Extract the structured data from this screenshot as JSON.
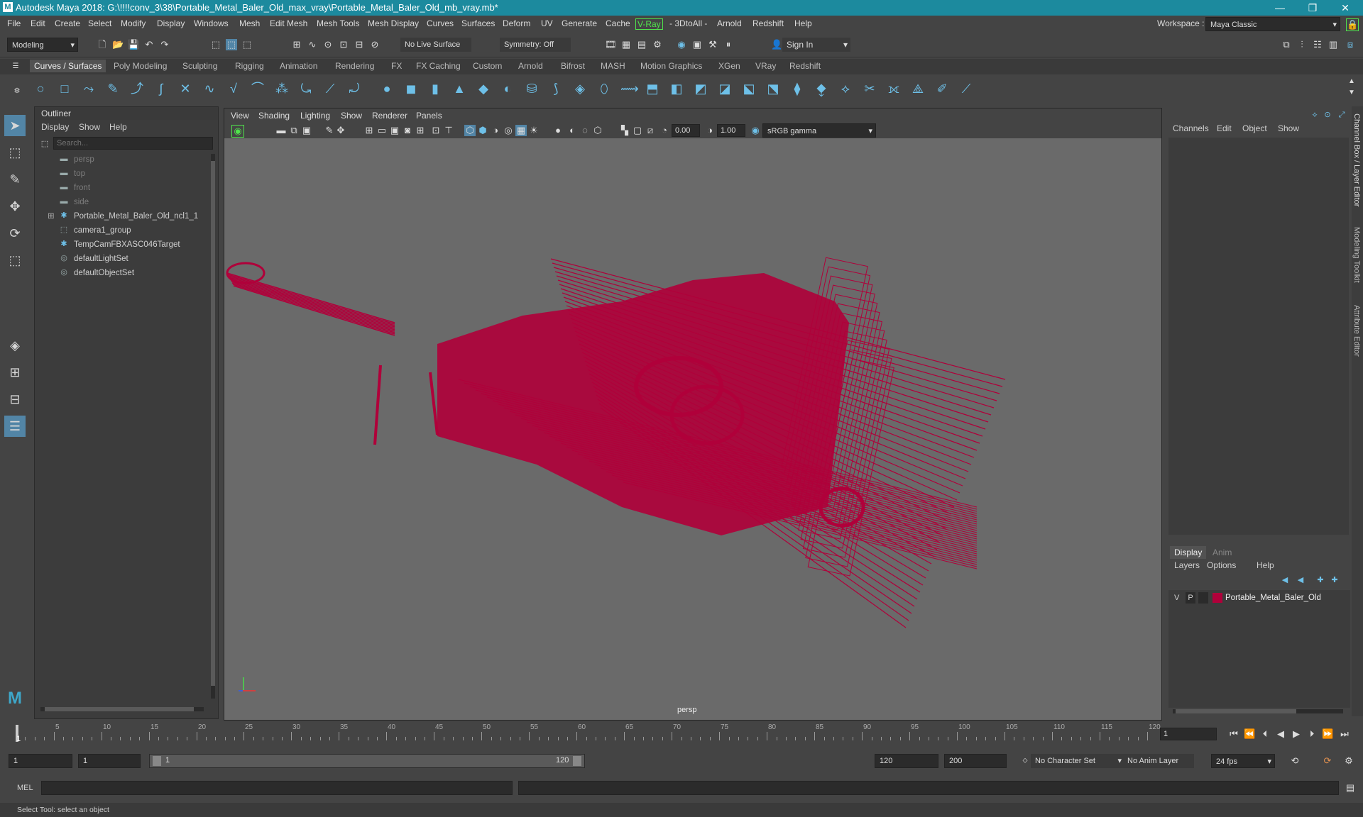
{
  "title_bar": {
    "logo": "M",
    "title": "Autodesk Maya 2018: G:\\!!!!conv_3\\38\\Portable_Metal_Baler_Old_max_vray\\Portable_Metal_Baler_Old_mb_vray.mb*",
    "minimize": "—",
    "maximize": "❐",
    "close": "✕"
  },
  "menubar": {
    "items": [
      "File",
      "Edit",
      "Create",
      "Select",
      "Modify",
      "Display",
      "Windows",
      "Mesh",
      "Edit Mesh",
      "Mesh Tools",
      "Mesh Display",
      "Curves",
      "Surfaces",
      "Deform",
      "UV",
      "Generate",
      "Cache",
      "V-Ray",
      "- 3DtoAll -",
      "Arnold",
      "Redshift",
      "Help"
    ],
    "workspace_label": "Workspace :",
    "workspace_value": "Maya Classic"
  },
  "status_line": {
    "mode": "Modeling",
    "live_surface": "No Live Surface",
    "symmetry": "Symmetry: Off",
    "sign_in": "Sign In"
  },
  "shelf": {
    "tabs": [
      "Curves / Surfaces",
      "Poly Modeling",
      "Sculpting",
      "Rigging",
      "Animation",
      "Rendering",
      "FX",
      "FX Caching",
      "Custom",
      "Arnold",
      "Bifrost",
      "MASH",
      "Motion Graphics",
      "XGen",
      "VRay",
      "Redshift"
    ],
    "active_tab": "Curves / Surfaces"
  },
  "outliner": {
    "title": "Outliner",
    "menu": [
      "Display",
      "Show",
      "Help"
    ],
    "search_placeholder": "Search...",
    "items": [
      {
        "label": "persp",
        "icon": "camera-icon",
        "dim": true
      },
      {
        "label": "top",
        "icon": "camera-icon",
        "dim": true
      },
      {
        "label": "front",
        "icon": "camera-icon",
        "dim": true
      },
      {
        "label": "side",
        "icon": "camera-icon",
        "dim": true
      },
      {
        "label": "Portable_Metal_Baler_Old_ncl1_1",
        "icon": "group-icon",
        "dim": false,
        "expandable": true
      },
      {
        "label": "camera1_group",
        "icon": "group-icon",
        "dim": false
      },
      {
        "label": "TempCamFBXASC046Target",
        "icon": "locator-icon",
        "dim": false
      },
      {
        "label": "defaultLightSet",
        "icon": "set-icon",
        "dim": false
      },
      {
        "label": "defaultObjectSet",
        "icon": "set-icon",
        "dim": false
      }
    ]
  },
  "viewport": {
    "menu": [
      "View",
      "Shading",
      "Lighting",
      "Show",
      "Renderer",
      "Panels"
    ],
    "near_value": "0.00",
    "far_value": "1.00",
    "color_space": "sRGB gamma",
    "camera_label": "persp",
    "wire_color": "#b0003a"
  },
  "channel_box": {
    "menu": [
      "Channels",
      "Edit",
      "Object",
      "Show"
    ]
  },
  "layer_editor": {
    "tabs": [
      "Display",
      "Anim"
    ],
    "active_tab": "Display",
    "menu": [
      "Layers",
      "Options",
      "Help"
    ],
    "layers": [
      {
        "v": "V",
        "p": "P",
        "color": "#b0003a",
        "name": "Portable_Metal_Baler_Old"
      }
    ]
  },
  "side_tabs": [
    "Channel Box / Layer Editor",
    "Modeling Toolkit",
    "Attribute Editor"
  ],
  "timeline": {
    "ticks": [
      "5",
      "10",
      "15",
      "20",
      "25",
      "30",
      "35",
      "40",
      "45",
      "50",
      "55",
      "60",
      "65",
      "70",
      "75",
      "80",
      "85",
      "90",
      "95",
      "100",
      "105",
      "110",
      "115",
      "120"
    ],
    "current_marker": "1",
    "current_frame": "1"
  },
  "range": {
    "start": "1",
    "playback_start": "1",
    "slider_start": "1",
    "slider_end": "120",
    "playback_end": "120",
    "end": "200",
    "character_set": "No Character Set",
    "anim_layer": "No Anim Layer",
    "fps": "24 fps"
  },
  "command_line": {
    "label": "MEL"
  },
  "help_line": {
    "text": "Select Tool: select an object"
  }
}
